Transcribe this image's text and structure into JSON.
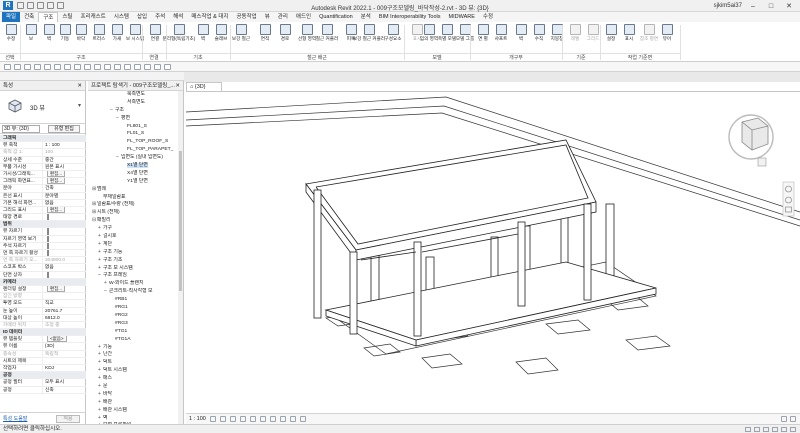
{
  "title_bar": {
    "title": "Autodesk Revit 2022.1 - 009구조모델링_바닥작성-2.rvt - 3D 뷰: {3D}",
    "user": "sjkim5ai37",
    "minimize": "–",
    "maximize": "□",
    "close": "✕"
  },
  "ribbon_tabs": [
    "파일",
    "건축",
    "구조",
    "스틸",
    "프리캐스트",
    "시스템",
    "삽입",
    "주석",
    "해석",
    "매스작업 & 대지",
    "공동작업",
    "뷰",
    "관리",
    "애드인",
    "Quantification",
    "분석",
    "BIM Interoperability Tools",
    "MIDWARE",
    "수정"
  ],
  "ribbon_active_tab": "구조",
  "ribbon_buttons": [
    {
      "label": "수정",
      "disabled": false
    },
    {
      "label": "보",
      "disabled": false
    },
    {
      "label": "벽",
      "disabled": false
    },
    {
      "label": "기둥",
      "disabled": false
    },
    {
      "label": "바닥",
      "disabled": false
    },
    {
      "label": "트러스",
      "disabled": false
    },
    {
      "label": "가새",
      "disabled": false
    },
    {
      "label": "보 시스템",
      "disabled": false
    },
    {
      "label": "연결",
      "disabled": false
    },
    {
      "label": "분리형(독립기초)",
      "disabled": false
    },
    {
      "label": "벽",
      "disabled": false
    },
    {
      "label": "슬래브",
      "disabled": false
    },
    {
      "label": "보강 철근",
      "disabled": false
    },
    {
      "label": "면적",
      "disabled": false
    },
    {
      "label": "경로",
      "disabled": false
    },
    {
      "label": "선형 영역",
      "disabled": false
    },
    {
      "label": "철근 커플러",
      "disabled": false
    },
    {
      "label": "피복",
      "disabled": false
    },
    {
      "label": "보강 철근 커플러",
      "disabled": false
    },
    {
      "label": "구성요소",
      "disabled": false
    },
    {
      "label": "표시",
      "disabled": true
    },
    {
      "label": "임의 영역",
      "disabled": false
    },
    {
      "label": "축별 모델",
      "disabled": false
    },
    {
      "label": "모델 그룹",
      "disabled": false
    },
    {
      "label": "면 별",
      "disabled": false
    },
    {
      "label": "샤프트",
      "disabled": false
    },
    {
      "label": "벽",
      "disabled": false
    },
    {
      "label": "수직",
      "disabled": false
    },
    {
      "label": "지붕창",
      "disabled": false
    },
    {
      "label": "레벨",
      "disabled": true
    },
    {
      "label": "그리드",
      "disabled": true
    },
    {
      "label": "설정",
      "disabled": false
    },
    {
      "label": "표시",
      "disabled": false
    },
    {
      "label": "참조 평면",
      "disabled": true
    },
    {
      "label": "뷰어",
      "disabled": false
    }
  ],
  "ribbon_panels": [
    "선택",
    "구조",
    "연결",
    "기초",
    "철근 배근",
    "모델",
    "개구부",
    "기준",
    "작업 기준면"
  ],
  "properties": {
    "header": "특성",
    "close": "✕",
    "type_name": "3D 뷰",
    "dropdown": "▾",
    "instance_selector": "3D 뷰: {3D}",
    "edit_type": "유형 편집",
    "rows": [
      {
        "k": "그래픽",
        "v": "",
        "kind": "cat"
      },
      {
        "k": "뷰 축척",
        "v": "1 : 100"
      },
      {
        "k": "축척 값 1:",
        "v": "100",
        "kind": "grey"
      },
      {
        "k": "상세 수준",
        "v": "중간"
      },
      {
        "k": "부품 가시성",
        "v": "원본 표시"
      },
      {
        "k": "가시성/그래픽...",
        "v": "편집...",
        "kind": "btn"
      },
      {
        "k": "그래픽 화면표...",
        "v": "편집...",
        "kind": "btn"
      },
      {
        "k": "분야",
        "v": "건축"
      },
      {
        "k": "은선 표시",
        "v": "분야별"
      },
      {
        "k": "기본 해석 화면...",
        "v": "없음"
      },
      {
        "k": "그리드 표시",
        "v": "편집...",
        "kind": "btn"
      },
      {
        "k": "태양 경로",
        "v": "",
        "kind": "chk"
      },
      {
        "k": "범위",
        "v": "",
        "kind": "cat"
      },
      {
        "k": "뷰 자르기",
        "v": "",
        "kind": "chk"
      },
      {
        "k": "자르기 영역 보기",
        "v": "",
        "kind": "chk"
      },
      {
        "k": "주석 자르기",
        "v": "",
        "kind": "chk"
      },
      {
        "k": "먼 쪽 자르기 활성",
        "v": "",
        "kind": "chk"
      },
      {
        "k": "먼 쪽 자르기 오...",
        "v": "304800.0",
        "kind": "grey"
      },
      {
        "k": "스코프 박스",
        "v": "없음"
      },
      {
        "k": "단면 상자",
        "v": "",
        "kind": "chk"
      },
      {
        "k": "카메라",
        "v": "",
        "kind": "cat"
      },
      {
        "k": "렌더링 설정",
        "v": "편집...",
        "kind": "btn"
      },
      {
        "k": "잠긴 방향",
        "v": "",
        "kind": "grey"
      },
      {
        "k": "투영 모드",
        "v": "직교"
      },
      {
        "k": "눈 높이",
        "v": "20761.7"
      },
      {
        "k": "대상 높이",
        "v": "6812.0"
      },
      {
        "k": "카메라 위치",
        "v": "조정 중",
        "kind": "grey"
      },
      {
        "k": "ID 데이터",
        "v": "",
        "kind": "cat"
      },
      {
        "k": "뷰 템플릿",
        "v": "<없음>",
        "kind": "btn"
      },
      {
        "k": "뷰 이름",
        "v": "{3D}"
      },
      {
        "k": "종속성",
        "v": "독립적",
        "kind": "grey"
      },
      {
        "k": "시트의 제목",
        "v": ""
      },
      {
        "k": "작업자",
        "v": "KDJ"
      },
      {
        "k": "공정",
        "v": "",
        "kind": "cat"
      },
      {
        "k": "공정 필터",
        "v": "모두 표시"
      },
      {
        "k": "공정",
        "v": "신축"
      }
    ],
    "help_link": "특성 도움말",
    "apply_button": "적용"
  },
  "browser": {
    "header": "프로젝트 탐색기 - 009구조모델링_...",
    "close": "✕",
    "nodes": [
      {
        "label": "북측면도",
        "level": 5,
        "toggle": ""
      },
      {
        "label": "서측면도",
        "level": 5,
        "toggle": ""
      },
      {
        "label": "구조",
        "level": 3,
        "toggle": "–"
      },
      {
        "label": "평면",
        "level": 4,
        "toggle": "–"
      },
      {
        "label": "FL801_S",
        "level": 5,
        "toggle": ""
      },
      {
        "label": "FL01_S",
        "level": 5,
        "toggle": ""
      },
      {
        "label": "FL_TOP_ROOF_S",
        "level": 5,
        "toggle": ""
      },
      {
        "label": "FL_TOP_PARAPET_",
        "level": 5,
        "toggle": ""
      },
      {
        "label": "입면도 (실내 입면도)",
        "level": 4,
        "toggle": "–"
      },
      {
        "label": "X1열 단면",
        "level": 5,
        "toggle": "",
        "sel": true
      },
      {
        "label": "X4열 단면",
        "level": 5,
        "toggle": ""
      },
      {
        "label": "Y1열 단면",
        "level": 5,
        "toggle": ""
      },
      {
        "label": "범례",
        "level": 0,
        "toggle": "⊞"
      },
      {
        "label": "부재일람표",
        "level": 1,
        "toggle": ""
      },
      {
        "label": "일람표/수량 (전체)",
        "level": 0,
        "toggle": "⊞"
      },
      {
        "label": "시트 (전체)",
        "level": 0,
        "toggle": "⊞"
      },
      {
        "label": "패밀리",
        "level": 0,
        "toggle": "⊟"
      },
      {
        "label": "가구",
        "level": 1,
        "toggle": "+"
      },
      {
        "label": "걸시호",
        "level": 1,
        "toggle": "+"
      },
      {
        "label": "계단",
        "level": 1,
        "toggle": "+"
      },
      {
        "label": "구조 기둥",
        "level": 1,
        "toggle": "+"
      },
      {
        "label": "구조 기초",
        "level": 1,
        "toggle": "+"
      },
      {
        "label": "구조 보 시스템",
        "level": 1,
        "toggle": "+"
      },
      {
        "label": "구조 프레임",
        "level": 1,
        "toggle": "–"
      },
      {
        "label": "W-와이드 플랜지",
        "level": 2,
        "toggle": "+"
      },
      {
        "label": "콘크리트-직사각형 보",
        "level": 2,
        "toggle": "–"
      },
      {
        "label": "#RB1",
        "level": 3,
        "toggle": ""
      },
      {
        "label": "#RG1",
        "level": 3,
        "toggle": ""
      },
      {
        "label": "#RG2",
        "level": 3,
        "toggle": ""
      },
      {
        "label": "#RG3",
        "level": 3,
        "toggle": ""
      },
      {
        "label": "#TG1",
        "level": 3,
        "toggle": ""
      },
      {
        "label": "#TG1A",
        "level": 3,
        "toggle": ""
      },
      {
        "label": "기둥",
        "level": 1,
        "toggle": "+"
      },
      {
        "label": "난간",
        "level": 1,
        "toggle": "+"
      },
      {
        "label": "덕트",
        "level": 1,
        "toggle": "+"
      },
      {
        "label": "덕트 시스템",
        "level": 1,
        "toggle": "+"
      },
      {
        "label": "매스",
        "level": 1,
        "toggle": "+"
      },
      {
        "label": "문",
        "level": 1,
        "toggle": "+"
      },
      {
        "label": "바닥",
        "level": 1,
        "toggle": "+"
      },
      {
        "label": "배관",
        "level": 1,
        "toggle": "+"
      },
      {
        "label": "배관 시스템",
        "level": 1,
        "toggle": "+"
      },
      {
        "label": "벽",
        "level": 1,
        "toggle": "+"
      },
      {
        "label": "보철 프로파일",
        "level": 1,
        "toggle": "+"
      },
      {
        "label": "상세 항목",
        "level": 1,
        "toggle": "+"
      }
    ]
  },
  "view_tab": "{3D}",
  "view_control": {
    "scale": "1 : 100"
  },
  "status_bar": {
    "text": "선택하려면 클릭하십시오."
  }
}
